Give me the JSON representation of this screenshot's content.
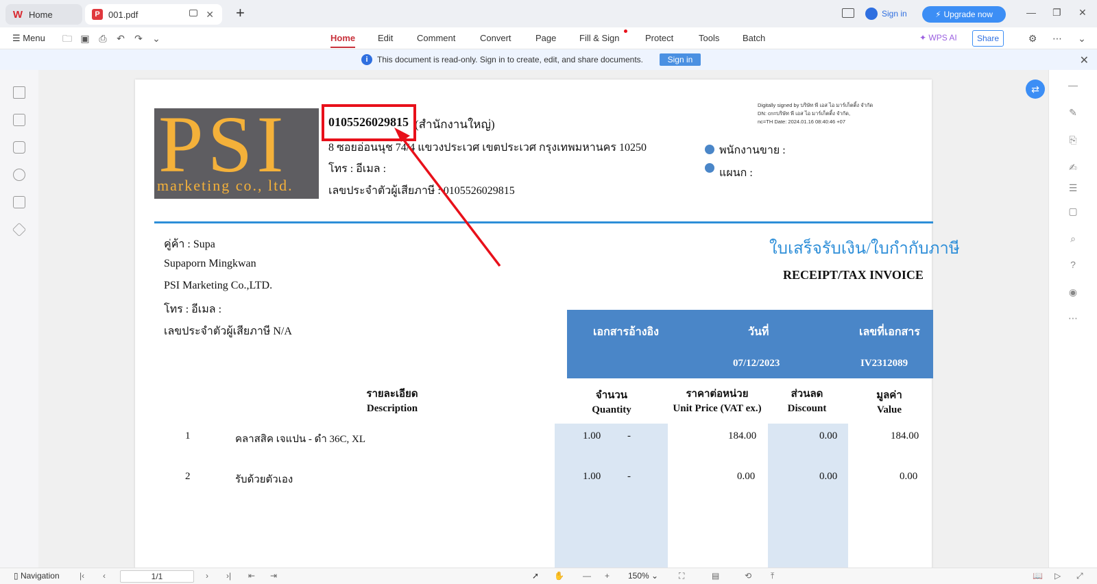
{
  "titlebar": {
    "home_tab": "Home",
    "doc_tab": "001.pdf",
    "sign_in": "Sign in",
    "upgrade": "Upgrade now"
  },
  "menubar": {
    "menu": "Menu",
    "tabs": [
      "Home",
      "Edit",
      "Comment",
      "Convert",
      "Page",
      "Fill & Sign",
      "Protect",
      "Tools",
      "Batch"
    ],
    "wps_ai": "WPS AI",
    "share": "Share"
  },
  "banner": {
    "message": "This document is read-only. Sign in to create, edit, and share documents.",
    "button": "Sign in"
  },
  "document": {
    "logo_big": "PSI",
    "logo_sub": "marketing co., ltd.",
    "company_id": "0105526029815",
    "company_branch": "(สำนักงานใหญ่)",
    "address": "8 ซอยอ่อนนุช 74/4 แขวงประเวศ เขตประเวศ กรุงเทพมหานคร 10250",
    "phone_email": "โทร :  อีเมล :",
    "taxid": "เลขประจำตัวผู้เสียภาษี : 0105526029815",
    "signature": [
      "Digitally signed by บริษัท พี เอส ไอ มาร์เก็ตติ้ง จำกัด",
      "DN: cn=บริษัท พี เอส ไอ มาร์เก็ตติ้ง จำกัด,",
      "nc=TH Date: 2024.01.16 08:40:46 +07"
    ],
    "salesperson": "พนักงานขาย :",
    "department": "แผนก :",
    "customer_label": "คู่ค้า : Supa",
    "customer_name": "Supaporn Mingkwan",
    "customer_company": "PSI Marketing Co.,LTD.",
    "customer_phone": "โทร :  อีเมล :",
    "customer_tax": "เลขประจำตัวผู้เสียภาษี   N/A",
    "title_th": "ใบเสร็จรับเงิน/ใบกำกับภาษี",
    "title_en": "RECEIPT/TAX INVOICE",
    "ref_header": "เอกสารอ้างอิง",
    "date_header": "วันที่",
    "docno_header": "เลขที่เอกสาร",
    "date_value": "07/12/2023",
    "docno_value": "IV2312089",
    "col_desc_th": "รายละเอียด",
    "col_desc_en": "Description",
    "col_qty_th": "จำนวน",
    "col_qty_en": "Quantity",
    "col_price_th": "ราคาต่อหน่วย",
    "col_price_en": "Unit Price (VAT ex.)",
    "col_disc_th": "ส่วนลด",
    "col_disc_en": "Discount",
    "col_val_th": "มูลค่า",
    "col_val_en": "Value",
    "rows": [
      {
        "no": "1",
        "desc": "คลาสสิค เจแปน - ดำ 36C, XL",
        "qty": "1.00",
        "unit": "-",
        "price": "184.00",
        "disc": "0.00",
        "value": "184.00"
      },
      {
        "no": "2",
        "desc": "รับด้วยตัวเอง",
        "qty": "1.00",
        "unit": "-",
        "price": "0.00",
        "disc": "0.00",
        "value": "0.00"
      }
    ]
  },
  "statusbar": {
    "navigation": "Navigation",
    "page": "1/1",
    "zoom": "150%"
  },
  "colors": {
    "accent_red": "#c8303a",
    "highlight_red": "#e8101a",
    "blue_header": "#4a86c8",
    "light_blue_col": "#dae6f3",
    "logo_bg": "#5e5d61",
    "logo_fg": "#f4b13a"
  }
}
